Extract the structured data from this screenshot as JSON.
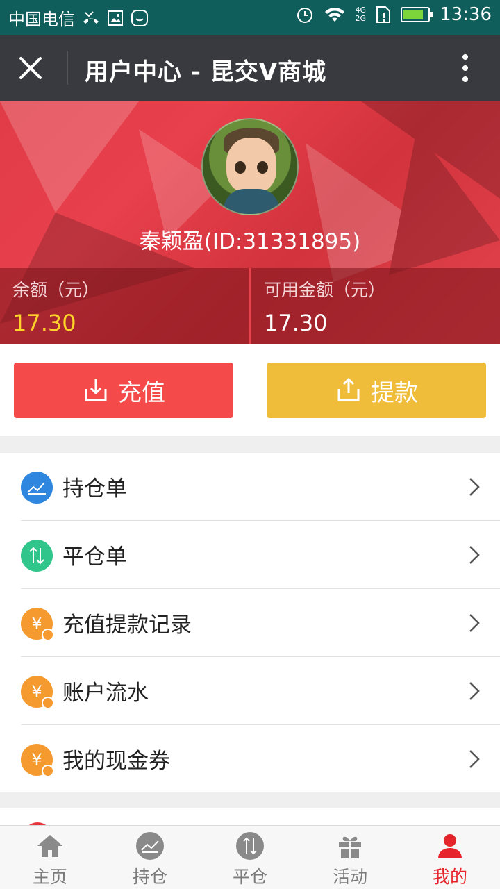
{
  "status_bar": {
    "carrier": "中国电信",
    "network_badge_top": "4G",
    "network_badge_bottom": "2G",
    "time": "13:36"
  },
  "nav": {
    "title": "用户中心 - 昆交V商城"
  },
  "profile": {
    "username": "秦颖盈(ID:31331895)",
    "balance_label": "余额（元）",
    "balance_value": "17.30",
    "available_label": "可用金额（元）",
    "available_value": "17.30"
  },
  "actions": {
    "recharge_label": "充值",
    "withdraw_label": "提款"
  },
  "menu": {
    "items": [
      {
        "label": "持仓单",
        "icon": "chart-up-icon",
        "color": "#2e86de"
      },
      {
        "label": "平仓单",
        "icon": "up-down-arrows-icon",
        "color": "#2fc58b"
      },
      {
        "label": "充值提款记录",
        "icon": "yen-icon",
        "color": "#f59a2f"
      },
      {
        "label": "账户流水",
        "icon": "yen-icon",
        "color": "#f59a2f"
      },
      {
        "label": "我的现金券",
        "icon": "yen-icon",
        "color": "#f59a2f"
      }
    ]
  },
  "tabbar": {
    "tabs": [
      {
        "label": "主页",
        "icon": "home-icon"
      },
      {
        "label": "持仓",
        "icon": "chart-up-icon"
      },
      {
        "label": "平仓",
        "icon": "up-down-arrows-icon"
      },
      {
        "label": "活动",
        "icon": "gift-icon"
      },
      {
        "label": "我的",
        "icon": "user-icon",
        "active": true
      }
    ]
  },
  "colors": {
    "primary_red": "#e5252b",
    "recharge": "#f44a4a",
    "withdraw": "#f0bd3a",
    "balance_yellow": "#ffd42a",
    "nav_bg": "#393a3f",
    "status_bg": "#0f5e5c"
  }
}
